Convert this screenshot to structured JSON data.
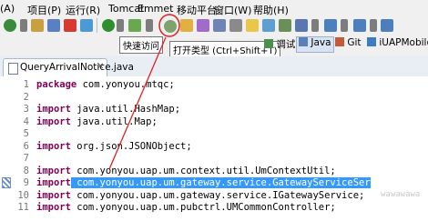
{
  "menu": [
    {
      "label": "(A)"
    },
    {
      "label": "项目(P)"
    },
    {
      "label": "运行(R)"
    },
    {
      "label": "Tomcat"
    },
    {
      "label": "Emmet"
    },
    {
      "label": "移动平台"
    },
    {
      "label": "窗口(W)"
    },
    {
      "label": "帮助(H)"
    }
  ],
  "toolbar": {
    "tooltip_quick_access": "快速访问",
    "tooltip_open_type": "打开类型 (Ctrl+Shift+T)",
    "perspectives": {
      "debug": "调试",
      "java": "Java",
      "git": "Git",
      "iuap": "iUAPMobile"
    }
  },
  "editor": {
    "tab_label": "QueryArrivalNotice.java",
    "tab_close": "✕",
    "lines": [
      {
        "num": "1",
        "kw": "package",
        "text": " com.yonyou.mtqc;"
      },
      {
        "num": "2",
        "kw": "",
        "text": ""
      },
      {
        "num": "3",
        "kw": "import",
        "text": " java.util.HashMap;"
      },
      {
        "num": "4",
        "kw": "import",
        "text": " java.util.Map;"
      },
      {
        "num": "5",
        "kw": "",
        "text": ""
      },
      {
        "num": "6",
        "kw": "import",
        "text": " org.json.JSONObject;"
      },
      {
        "num": "7",
        "kw": "",
        "text": ""
      },
      {
        "num": "8",
        "kw": "import",
        "text": " com.yonyou.uap.um.context.util.UmContextUtil;"
      },
      {
        "num": "9",
        "kw": "import",
        "text": " com.yonyou.uap.um.gateway.service.GatewayServiceSer"
      },
      {
        "num": "10",
        "kw": "import",
        "text": " com.yonyou.uap.um.gateway.service.IGatewayService;"
      },
      {
        "num": "11",
        "kw": "import",
        "text": " com.yonyou.uap.um.pubctrl.UMCommonController;"
      }
    ],
    "ghost_text": "wawawawa"
  }
}
